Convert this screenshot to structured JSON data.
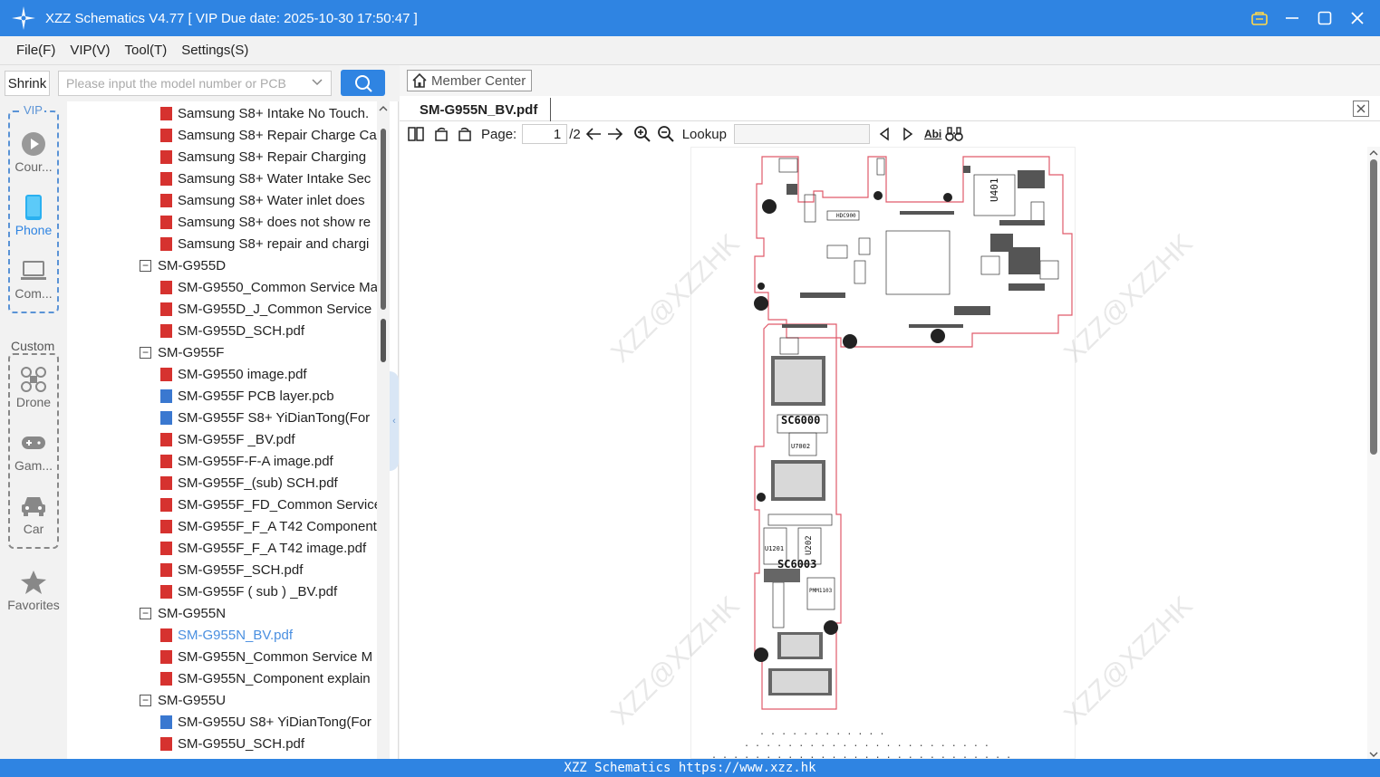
{
  "window": {
    "title": "XZZ Schematics V4.77 [ VIP Due date: 2025-10-30 17:50:47 ]"
  },
  "menu": [
    "File(F)",
    "VIP(V)",
    "Tool(T)",
    "Settings(S)"
  ],
  "search": {
    "shrink_label": "Shrink",
    "placeholder": "Please input the model number or PCB"
  },
  "sidebar": {
    "vip_label": "VIP",
    "custom_label": "Custom",
    "vip_items": [
      {
        "label": "Cour...",
        "icon": "play-circle-icon"
      },
      {
        "label": "Phone",
        "icon": "phone-icon"
      },
      {
        "label": "Com...",
        "icon": "laptop-icon"
      }
    ],
    "custom_items": [
      {
        "label": "Drone",
        "icon": "drone-icon"
      },
      {
        "label": "Gam...",
        "icon": "gamepad-icon"
      },
      {
        "label": "Car",
        "icon": "car-icon"
      }
    ],
    "favorites_label": "Favorites"
  },
  "tree": [
    {
      "type": "pdf",
      "label": "Samsung S8+ Intake No Touch."
    },
    {
      "type": "pdf",
      "label": "Samsung S8+ Repair Charge Ca"
    },
    {
      "type": "pdf",
      "label": "Samsung S8+ Repair Charging"
    },
    {
      "type": "pdf",
      "label": "Samsung S8+ Water Intake Sec"
    },
    {
      "type": "pdf",
      "label": "Samsung S8+ Water inlet does"
    },
    {
      "type": "pdf",
      "label": "Samsung S8+ does not show re"
    },
    {
      "type": "pdf",
      "label": "Samsung S8+ repair and chargi"
    },
    {
      "type": "folder",
      "label": "SM-G955D"
    },
    {
      "type": "pdf",
      "label": "SM-G9550_Common Service Ma"
    },
    {
      "type": "pdf",
      "label": "SM-G955D_J_Common Service"
    },
    {
      "type": "pdf",
      "label": "SM-G955D_SCH.pdf"
    },
    {
      "type": "folder",
      "label": "SM-G955F"
    },
    {
      "type": "pdf",
      "label": "SM-G9550 image.pdf"
    },
    {
      "type": "pcb",
      "label": "SM-G955F PCB layer.pcb"
    },
    {
      "type": "pcb",
      "label": "SM-G955F S8+ YiDianTong(For"
    },
    {
      "type": "pdf",
      "label": "SM-G955F _BV.pdf"
    },
    {
      "type": "pdf",
      "label": "SM-G955F-F-A image.pdf"
    },
    {
      "type": "pdf",
      "label": "SM-G955F_(sub) SCH.pdf"
    },
    {
      "type": "pdf",
      "label": "SM-G955F_FD_Common Service"
    },
    {
      "type": "pdf",
      "label": "SM-G955F_F_A T42 Component"
    },
    {
      "type": "pdf",
      "label": "SM-G955F_F_A T42 image.pdf"
    },
    {
      "type": "pdf",
      "label": "SM-G955F_SCH.pdf"
    },
    {
      "type": "pdf",
      "label": "SM-G955F ( sub ) _BV.pdf"
    },
    {
      "type": "folder",
      "label": "SM-G955N"
    },
    {
      "type": "pdf",
      "label": "SM-G955N_BV.pdf",
      "selected": true
    },
    {
      "type": "pdf",
      "label": "SM-G955N_Common Service M"
    },
    {
      "type": "pdf",
      "label": "SM-G955N_Component explain"
    },
    {
      "type": "folder",
      "label": "SM-G955U"
    },
    {
      "type": "pcb",
      "label": "SM-G955U S8+ YiDianTong(For"
    },
    {
      "type": "pdf",
      "label": "SM-G955U_SCH.pdf"
    }
  ],
  "viewer": {
    "member_center": "Member Center",
    "active_tab": "SM-G955N_BV.pdf",
    "page_label": "Page:",
    "page_current": "1",
    "page_total": "/2",
    "lookup_label": "Lookup",
    "abi_label": "Abi",
    "watermark": "XZZ@XZZHK",
    "board_labels": [
      "U401",
      "SC6000",
      "U7002",
      "SC6003",
      "U1201",
      "U202",
      "PMM1103",
      "HDC900"
    ]
  },
  "footer": "XZZ Schematics https://www.xzz.hk",
  "colors": {
    "accent": "#2f84e2",
    "pdf_icon": "#d6322f",
    "pcb_icon": "#3a78d0",
    "board_outline": "#e05a6a"
  }
}
